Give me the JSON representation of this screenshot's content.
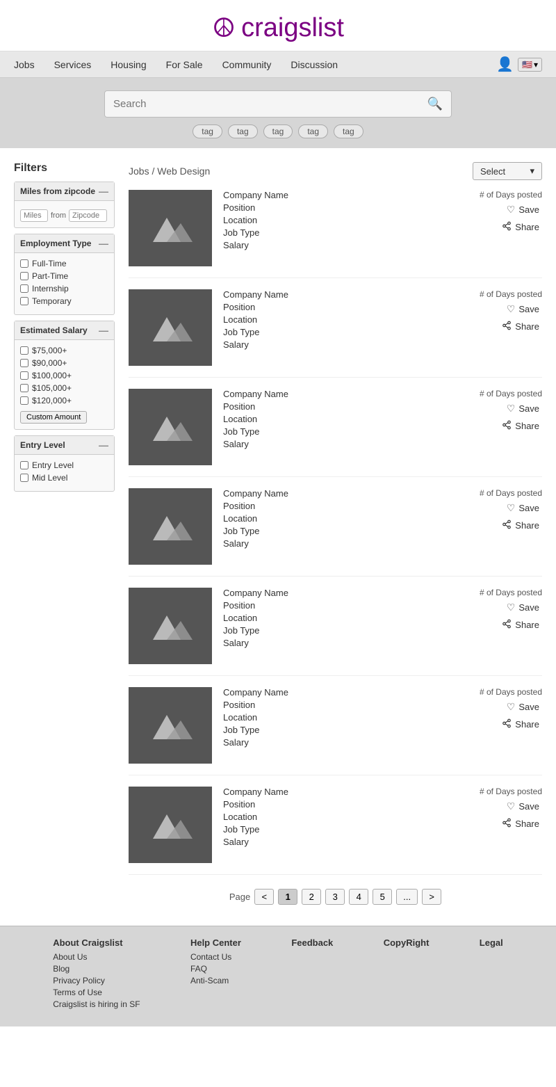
{
  "header": {
    "logo_text": "craigslist",
    "peace_symbol": "☮"
  },
  "nav": {
    "links": [
      "Jobs",
      "Services",
      "Housing",
      "For Sale",
      "Community",
      "Discussion"
    ],
    "flag": "🇺🇸"
  },
  "search": {
    "placeholder": "Search",
    "tags": [
      "tag",
      "tag",
      "tag",
      "tag",
      "tag"
    ]
  },
  "breadcrumb": {
    "part1": "Jobs",
    "separator": " / ",
    "part2": "Web Design"
  },
  "select": {
    "label": "Select"
  },
  "filters": {
    "title": "Filters",
    "sections": [
      {
        "id": "zipcode",
        "label": "Miles from zipcode",
        "miles_placeholder": "Miles",
        "from_label": "from",
        "zip_placeholder": "Zipcode"
      },
      {
        "id": "employment",
        "label": "Employment Type",
        "options": [
          "Full-Time",
          "Part-Time",
          "Internship",
          "Temporary"
        ]
      },
      {
        "id": "salary",
        "label": "Estimated Salary",
        "options": [
          "$75,000+",
          "$90,000+",
          "$100,000+",
          "$105,000+",
          "$120,000+"
        ],
        "custom_label": "Custom Amount"
      },
      {
        "id": "entry",
        "label": "Entry Level",
        "options": [
          "Entry Level",
          "Mid Level"
        ]
      }
    ]
  },
  "listings": [
    {
      "company": "Company Name",
      "position": "Position",
      "location": "Location",
      "job_type": "Job Type",
      "salary": "Salary",
      "days": "# of Days posted",
      "save": "Save",
      "share": "Share"
    },
    {
      "company": "Company Name",
      "position": "Position",
      "location": "Location",
      "job_type": "Job Type",
      "salary": "Salary",
      "days": "# of Days posted",
      "save": "Save",
      "share": "Share"
    },
    {
      "company": "Company Name",
      "position": "Position",
      "location": "Location",
      "job_type": "Job Type",
      "salary": "Salary",
      "days": "# of Days posted",
      "save": "Save",
      "share": "Share"
    },
    {
      "company": "Company Name",
      "position": "Position",
      "location": "Location",
      "job_type": "Job Type",
      "salary": "Salary",
      "days": "# of Days posted",
      "save": "Save",
      "share": "Share"
    },
    {
      "company": "Company Name",
      "position": "Position",
      "location": "Location",
      "job_type": "Job Type",
      "salary": "Salary",
      "days": "# of Days posted",
      "save": "Save",
      "share": "Share"
    },
    {
      "company": "Company Name",
      "position": "Position",
      "location": "Location",
      "job_type": "Job Type",
      "salary": "Salary",
      "days": "# of Days posted",
      "save": "Save",
      "share": "Share"
    },
    {
      "company": "Company Name",
      "position": "Position",
      "location": "Location",
      "job_type": "Job Type",
      "salary": "Salary",
      "days": "# of Days posted",
      "save": "Save",
      "share": "Share"
    }
  ],
  "pagination": {
    "label": "Page",
    "prev": "<",
    "pages": [
      "1",
      "2",
      "3",
      "4",
      "5",
      "..."
    ],
    "next": ">",
    "active": "1"
  },
  "footer": {
    "cols": [
      {
        "title": "About Craigslist",
        "links": [
          "About Us",
          "Blog",
          "Privacy Policy",
          "Terms of Use",
          "Craigslist is hiring in SF"
        ]
      },
      {
        "title": "Help Center",
        "links": [
          "Contact Us",
          "FAQ",
          "Anti-Scam"
        ]
      },
      {
        "title": "Feedback",
        "links": []
      },
      {
        "title": "CopyRight",
        "links": []
      },
      {
        "title": "Legal",
        "links": []
      }
    ]
  }
}
